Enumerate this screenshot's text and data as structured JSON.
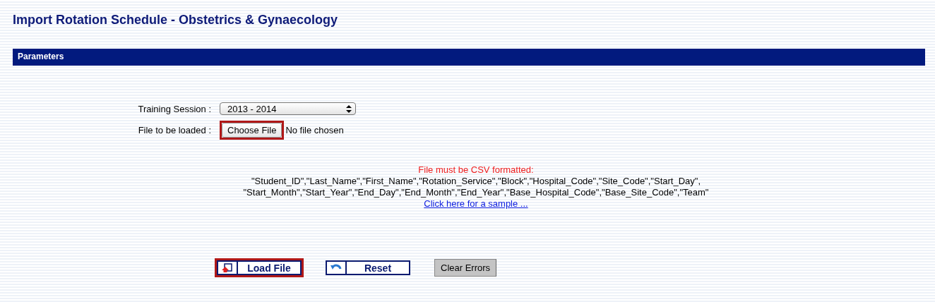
{
  "title": "Import Rotation Schedule - Obstetrics & Gynaecology",
  "section": {
    "title": "Parameters"
  },
  "form": {
    "session_label": "Training Session :",
    "session_value": "2013 - 2014",
    "file_label": "File to be loaded :",
    "choose_button": {
      "label": "Choose File",
      "highlighted": true
    },
    "file_status": "No file chosen"
  },
  "notice": {
    "warning": "File must be CSV formatted:",
    "lines": [
      "\"Student_ID\",\"Last_Name\",\"First_Name\",\"Rotation_Service\",\"Block\",\"Hospital_Code\",\"Site_Code\",\"Start_Day\",",
      "\"Start_Month\",\"Start_Year\",\"End_Day\",\"End_Month\",\"End_Year\",\"Base_Hospital_Code\",\"Base_Site_Code\",\"Team\""
    ],
    "link": "Click here for a sample ..."
  },
  "buttons": [
    {
      "kind": "load",
      "label": "Load File",
      "highlighted": true
    },
    {
      "kind": "reset",
      "label": "Reset",
      "highlighted": false
    },
    {
      "kind": "plain",
      "label": "Clear Errors",
      "highlighted": false
    }
  ]
}
